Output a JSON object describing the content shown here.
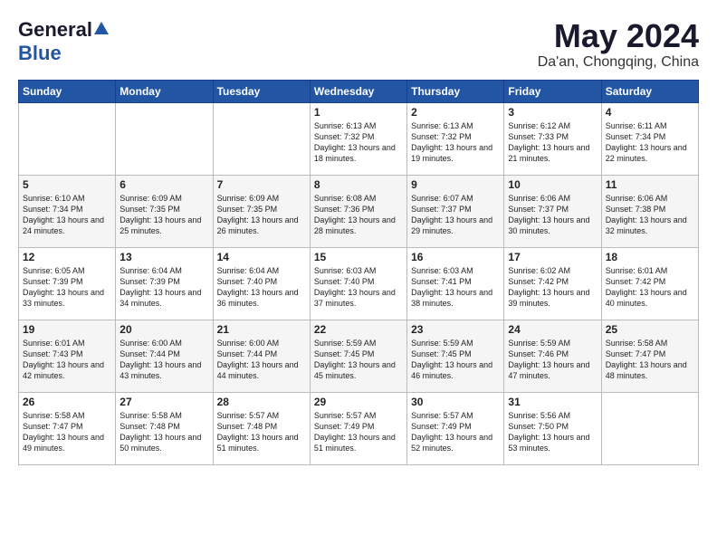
{
  "logo": {
    "general": "General",
    "blue": "Blue"
  },
  "title": "May 2024",
  "location": "Da'an, Chongqing, China",
  "days_of_week": [
    "Sunday",
    "Monday",
    "Tuesday",
    "Wednesday",
    "Thursday",
    "Friday",
    "Saturday"
  ],
  "weeks": [
    [
      {
        "day": "",
        "info": ""
      },
      {
        "day": "",
        "info": ""
      },
      {
        "day": "",
        "info": ""
      },
      {
        "day": "1",
        "info": "Sunrise: 6:13 AM\nSunset: 7:32 PM\nDaylight: 13 hours\nand 18 minutes."
      },
      {
        "day": "2",
        "info": "Sunrise: 6:13 AM\nSunset: 7:32 PM\nDaylight: 13 hours\nand 19 minutes."
      },
      {
        "day": "3",
        "info": "Sunrise: 6:12 AM\nSunset: 7:33 PM\nDaylight: 13 hours\nand 21 minutes."
      },
      {
        "day": "4",
        "info": "Sunrise: 6:11 AM\nSunset: 7:34 PM\nDaylight: 13 hours\nand 22 minutes."
      }
    ],
    [
      {
        "day": "5",
        "info": "Sunrise: 6:10 AM\nSunset: 7:34 PM\nDaylight: 13 hours\nand 24 minutes."
      },
      {
        "day": "6",
        "info": "Sunrise: 6:09 AM\nSunset: 7:35 PM\nDaylight: 13 hours\nand 25 minutes."
      },
      {
        "day": "7",
        "info": "Sunrise: 6:09 AM\nSunset: 7:35 PM\nDaylight: 13 hours\nand 26 minutes."
      },
      {
        "day": "8",
        "info": "Sunrise: 6:08 AM\nSunset: 7:36 PM\nDaylight: 13 hours\nand 28 minutes."
      },
      {
        "day": "9",
        "info": "Sunrise: 6:07 AM\nSunset: 7:37 PM\nDaylight: 13 hours\nand 29 minutes."
      },
      {
        "day": "10",
        "info": "Sunrise: 6:06 AM\nSunset: 7:37 PM\nDaylight: 13 hours\nand 30 minutes."
      },
      {
        "day": "11",
        "info": "Sunrise: 6:06 AM\nSunset: 7:38 PM\nDaylight: 13 hours\nand 32 minutes."
      }
    ],
    [
      {
        "day": "12",
        "info": "Sunrise: 6:05 AM\nSunset: 7:39 PM\nDaylight: 13 hours\nand 33 minutes."
      },
      {
        "day": "13",
        "info": "Sunrise: 6:04 AM\nSunset: 7:39 PM\nDaylight: 13 hours\nand 34 minutes."
      },
      {
        "day": "14",
        "info": "Sunrise: 6:04 AM\nSunset: 7:40 PM\nDaylight: 13 hours\nand 36 minutes."
      },
      {
        "day": "15",
        "info": "Sunrise: 6:03 AM\nSunset: 7:40 PM\nDaylight: 13 hours\nand 37 minutes."
      },
      {
        "day": "16",
        "info": "Sunrise: 6:03 AM\nSunset: 7:41 PM\nDaylight: 13 hours\nand 38 minutes."
      },
      {
        "day": "17",
        "info": "Sunrise: 6:02 AM\nSunset: 7:42 PM\nDaylight: 13 hours\nand 39 minutes."
      },
      {
        "day": "18",
        "info": "Sunrise: 6:01 AM\nSunset: 7:42 PM\nDaylight: 13 hours\nand 40 minutes."
      }
    ],
    [
      {
        "day": "19",
        "info": "Sunrise: 6:01 AM\nSunset: 7:43 PM\nDaylight: 13 hours\nand 42 minutes."
      },
      {
        "day": "20",
        "info": "Sunrise: 6:00 AM\nSunset: 7:44 PM\nDaylight: 13 hours\nand 43 minutes."
      },
      {
        "day": "21",
        "info": "Sunrise: 6:00 AM\nSunset: 7:44 PM\nDaylight: 13 hours\nand 44 minutes."
      },
      {
        "day": "22",
        "info": "Sunrise: 5:59 AM\nSunset: 7:45 PM\nDaylight: 13 hours\nand 45 minutes."
      },
      {
        "day": "23",
        "info": "Sunrise: 5:59 AM\nSunset: 7:45 PM\nDaylight: 13 hours\nand 46 minutes."
      },
      {
        "day": "24",
        "info": "Sunrise: 5:59 AM\nSunset: 7:46 PM\nDaylight: 13 hours\nand 47 minutes."
      },
      {
        "day": "25",
        "info": "Sunrise: 5:58 AM\nSunset: 7:47 PM\nDaylight: 13 hours\nand 48 minutes."
      }
    ],
    [
      {
        "day": "26",
        "info": "Sunrise: 5:58 AM\nSunset: 7:47 PM\nDaylight: 13 hours\nand 49 minutes."
      },
      {
        "day": "27",
        "info": "Sunrise: 5:58 AM\nSunset: 7:48 PM\nDaylight: 13 hours\nand 50 minutes."
      },
      {
        "day": "28",
        "info": "Sunrise: 5:57 AM\nSunset: 7:48 PM\nDaylight: 13 hours\nand 51 minutes."
      },
      {
        "day": "29",
        "info": "Sunrise: 5:57 AM\nSunset: 7:49 PM\nDaylight: 13 hours\nand 51 minutes."
      },
      {
        "day": "30",
        "info": "Sunrise: 5:57 AM\nSunset: 7:49 PM\nDaylight: 13 hours\nand 52 minutes."
      },
      {
        "day": "31",
        "info": "Sunrise: 5:56 AM\nSunset: 7:50 PM\nDaylight: 13 hours\nand 53 minutes."
      },
      {
        "day": "",
        "info": ""
      }
    ]
  ]
}
